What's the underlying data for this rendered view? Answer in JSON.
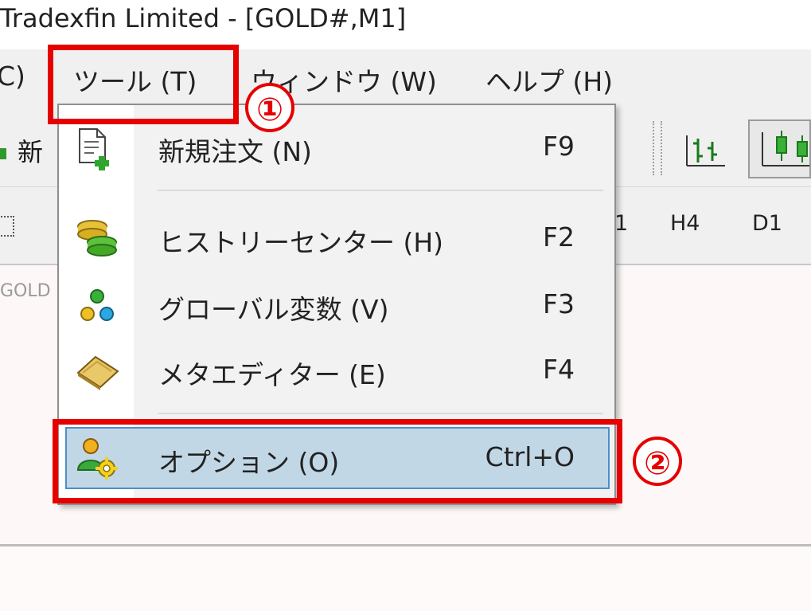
{
  "window": {
    "title": "Tradexfin Limited - [GOLD#,M1]"
  },
  "menubar": {
    "partial_left": "C)",
    "tools": "ツール (T)",
    "window": "ウィンドウ (W)",
    "help": "ヘルプ (H)"
  },
  "toolbar": {
    "new_order_partial": "新"
  },
  "timeframes": {
    "partial": "1",
    "h4": "H4",
    "d1": "D1"
  },
  "chart": {
    "symbol_partial": "GOLD"
  },
  "tools_menu": {
    "items": [
      {
        "label": "新規注文 (N)",
        "shortcut": "F9",
        "icon": "new-order-icon"
      },
      {
        "label": "ヒストリーセンター (H)",
        "shortcut": "F2",
        "icon": "history-center-icon"
      },
      {
        "label": "グローバル変数 (V)",
        "shortcut": "F3",
        "icon": "global-variables-icon"
      },
      {
        "label": "メタエディター (E)",
        "shortcut": "F4",
        "icon": "metaeditor-icon"
      },
      {
        "label": "オプション (O)",
        "shortcut": "Ctrl+O",
        "icon": "options-icon",
        "selected": true
      }
    ]
  },
  "annotations": {
    "step1": "①",
    "step2": "②"
  },
  "colors": {
    "highlight_red": "#e60000",
    "selection_bg": "#c2d7e6",
    "selection_border": "#4a8fc8"
  }
}
